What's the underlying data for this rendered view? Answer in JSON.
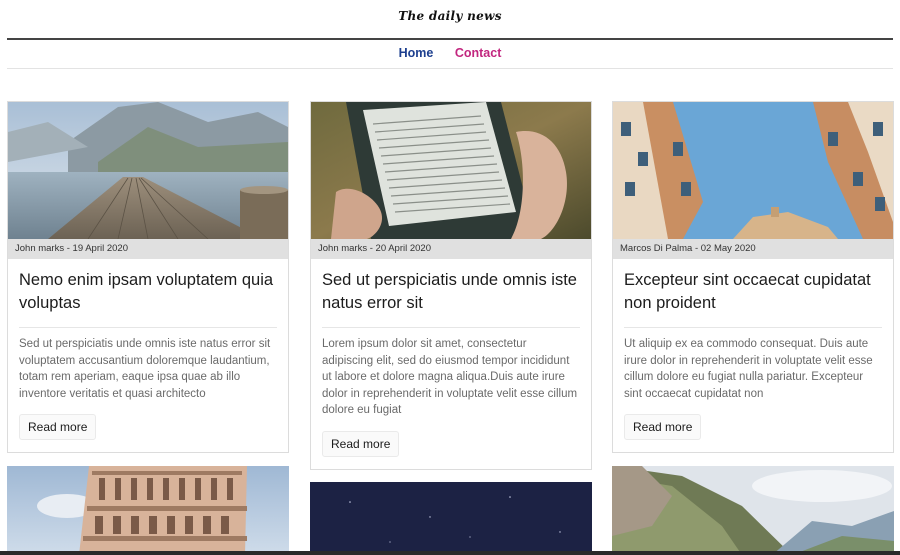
{
  "header": {
    "title": "The daily news"
  },
  "nav": {
    "home": "Home",
    "contact": "Contact"
  },
  "cards": [
    {
      "image": "mountain-lake-pier-photo",
      "meta": "John marks - 19 April 2020",
      "title": "Nemo enim ipsam voluptatem quia voluptas",
      "text": "Sed ut perspiciatis unde omnis iste natus error sit voluptatem accusantium doloremque laudantium, totam rem aperiam, eaque ipsa quae ab illo inventore veritatis et quasi architecto",
      "button": "Read more"
    },
    {
      "image": "e-reader-in-hand-photo",
      "meta": "John marks - 20 April 2020",
      "title": "Sed ut perspiciatis unde omnis iste natus error sit",
      "text": "Lorem ipsum dolor sit amet, consectetur adipiscing elit, sed do eiusmod tempor incididunt ut labore et dolore magna aliqua.Duis aute irure dolor in reprehenderit in voluptate velit esse cillum dolore eu fugiat",
      "button": "Read more"
    },
    {
      "image": "city-buildings-sky-photo",
      "meta": "Marcos Di Palma - 02 May 2020",
      "title": "Excepteur sint occaecat cupidatat non proident",
      "text": "Ut aliquip ex ea commodo consequat. Duis aute irure dolor in reprehenderit in voluptate velit esse cillum dolore eu fugiat nulla pariatur. Excepteur sint occaecat cupidatat non",
      "button": "Read more"
    }
  ],
  "bottom_images": [
    "leaning-tower-photo",
    "night-sky-photo",
    "mountain-valley-photo"
  ]
}
